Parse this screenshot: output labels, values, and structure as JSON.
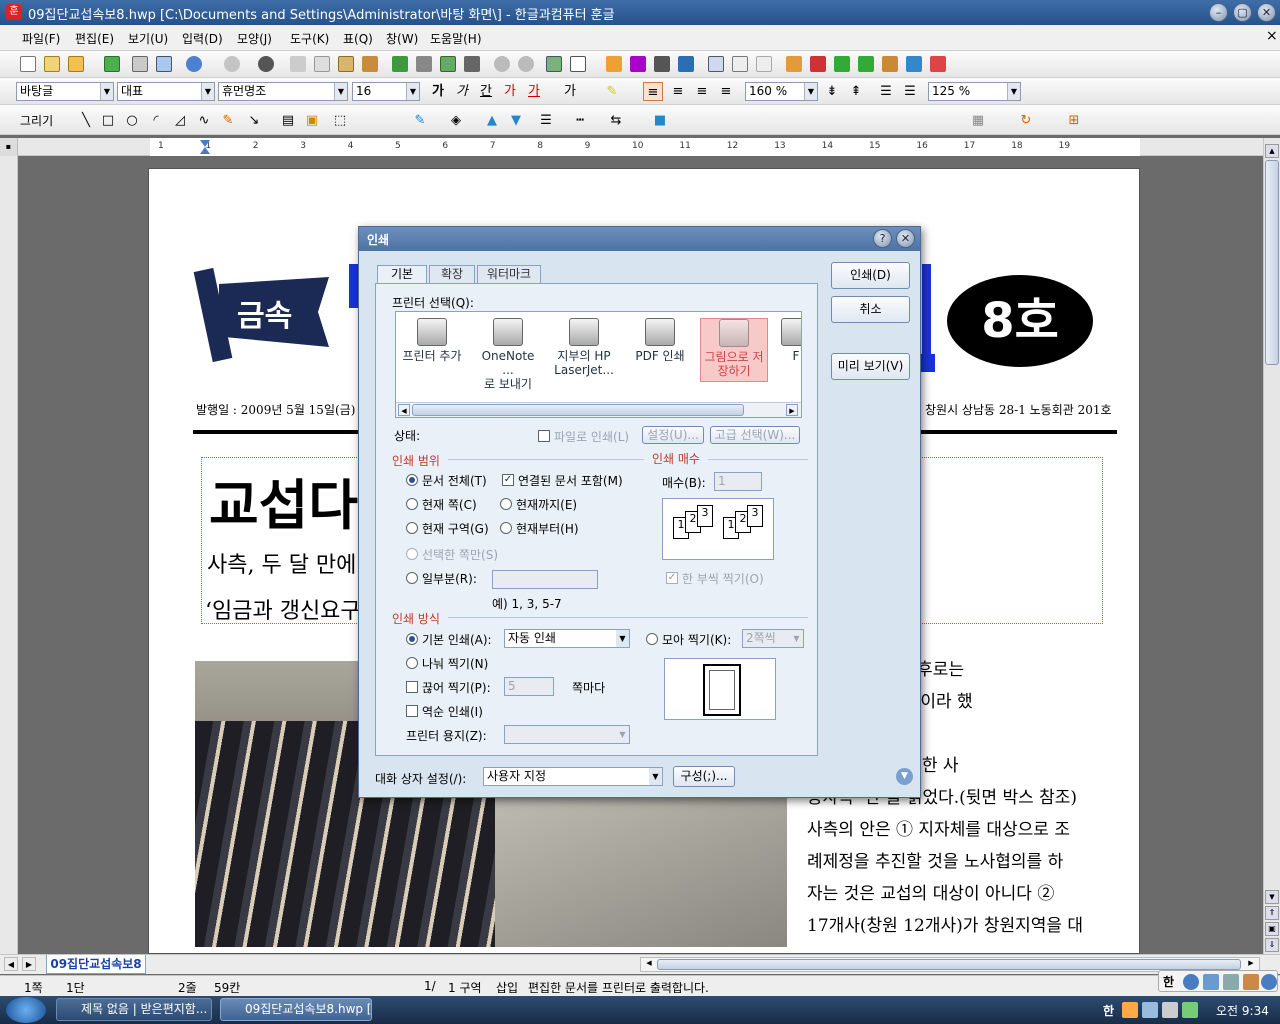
{
  "window": {
    "title": "09집단교섭속보8.hwp [C:\\Documents and Settings\\Administrator\\바탕 화면\\] - 한글과컴퓨터 훈글",
    "close_doc": "×"
  },
  "menu": [
    "파일(F)",
    "편집(E)",
    "보기(U)",
    "입력(D)",
    "모양(J)",
    "도구(K)",
    "표(Q)",
    "창(W)",
    "도움말(H)"
  ],
  "format_toolbar": {
    "style": "바탕글",
    "font_lang": "대표",
    "font": "휴먼명조",
    "size": "16",
    "line_spacing": "160 %",
    "zoom": "125 %"
  },
  "draw_toolbar": {
    "draw_label": "그리기"
  },
  "ruler": {
    "ticks": [
      "1",
      "1",
      "2",
      "3",
      "4",
      "5",
      "6",
      "7",
      "8",
      "9",
      "10",
      "11",
      "12",
      "13",
      "14",
      "15",
      "16",
      "17",
      "18",
      "19"
    ]
  },
  "document": {
    "issue": "8호",
    "logo_text": "금속",
    "pub_left": "발행일 : 2009년 5월 15일(금) ·",
    "pub_right": "창원시 상남동 28-1 노동회관 201호",
    "headline": "교섭다",
    "sub1": "사측, 두 달 만에",
    "sub2": "‘임금과 갱신요구",
    "body_lines": [
      "을 표시하며, 이후로는",
      "행하지 않을 것”이라 했",
      "",
      "우선요구안에 대한 사",
      "용자측 ‘안’을 읽었다.(뒷면 박스 참조)",
      "사측의 안은 ① 지자체를 대상으로 조",
      "례제정을 추진할 것을 노사협의를 하",
      "자는 것은 교섭의 대상이 아니다 ②",
      "17개사(창원 12개사)가 창원지역을 대"
    ]
  },
  "dialog": {
    "title": "인쇄",
    "tabs": [
      "기본",
      "확장",
      "워터마크"
    ],
    "printer_select_label": "프린터 선택(Q):",
    "printers": [
      {
        "line1": "프린터 추가",
        "line2": ""
      },
      {
        "line1": "OneNote ...",
        "line2": "로 보내기"
      },
      {
        "line1": "지부의 HP",
        "line2": "LaserJet..."
      },
      {
        "line1": "PDF 인쇄",
        "line2": ""
      },
      {
        "line1": "그림으로 저",
        "line2": "장하기"
      },
      {
        "line1": "F",
        "line2": ""
      }
    ],
    "status_label": "상태:",
    "print_to_file": "파일로 인쇄(L)",
    "settings_btn": "설정(U)...",
    "advanced_btn": "고급 선택(W)...",
    "range_title": "인쇄 범위",
    "range_all": "문서 전체(T)",
    "range_linked": "연결된 문서 포함(M)",
    "range_current_page": "현재 쪽(C)",
    "range_to_current": "현재까지(E)",
    "range_current_section": "현재 구역(G)",
    "range_from_current": "현재부터(H)",
    "range_selection": "선택한 쪽만(S)",
    "range_part": "일부분(R):",
    "range_example": "예) 1, 3, 5-7",
    "copies_title": "인쇄 매수",
    "copies_label": "매수(B):",
    "copies_value": "1",
    "collate": "한 부씩 찍기(O)",
    "method_title": "인쇄 방식",
    "method_basic": "기본 인쇄(A):",
    "method_basic_value": "자동 인쇄",
    "method_collect": "모아 찍기(K):",
    "method_collect_value": "2쪽씩",
    "method_split": "나눠 찍기(N)",
    "method_cut": "끊어 찍기(P):",
    "method_cut_value": "5",
    "method_cut_unit": "쪽마다",
    "method_reverse": "역순 인쇄(I)",
    "printer_paper": "프린터 용지(Z):",
    "dialog_settings_label": "대화 상자 설정(/):",
    "dialog_settings_value": "사용자 지정",
    "configure_btn": "구성(;)...",
    "print_btn": "인쇄(D)",
    "cancel_btn": "취소",
    "preview_btn": "미리 보기(V)"
  },
  "bottom_tab": "09집단교섭속보8",
  "status": {
    "page": "1쪽",
    "column": "1단",
    "line": "2줄",
    "col": "59칸",
    "page_of": "1/",
    "section": "1 구역",
    "mode": "삽입",
    "message": "편집한 문서를 프린터로 출력합니다."
  },
  "taskbar": {
    "items": [
      "제목 없음 | 받은편지함...",
      "09집단교섭속보8.hwp [..."
    ],
    "time": "오전 9:34",
    "ime": "한"
  }
}
